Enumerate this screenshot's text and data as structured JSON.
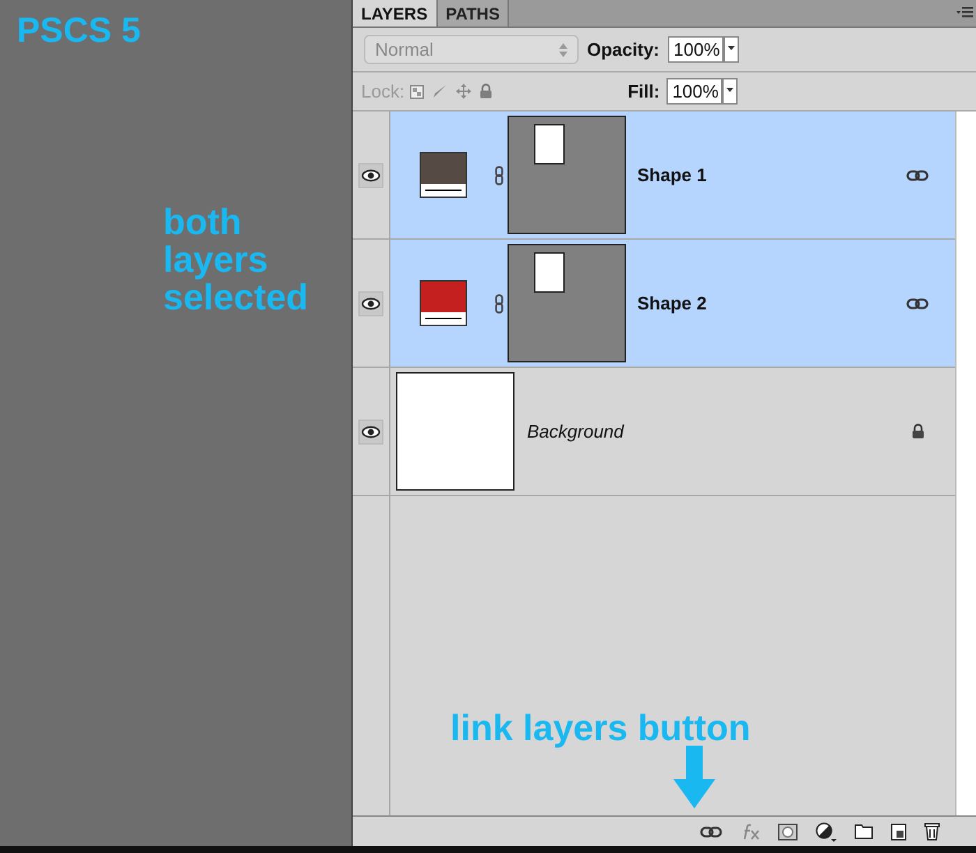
{
  "annotations": {
    "version": "PSCS 5",
    "note": "both layers selected",
    "callout": "link layers button"
  },
  "panel": {
    "tabs": [
      {
        "label": "LAYERS",
        "selected": true
      },
      {
        "label": "PATHS",
        "selected": false
      }
    ],
    "blend_mode": {
      "value": "Normal",
      "disabled": true
    },
    "opacity": {
      "label": "Opacity:",
      "value": "100%"
    },
    "lock": {
      "label": "Lock:",
      "disabled": true
    },
    "fill": {
      "label": "Fill:",
      "value": "100%"
    },
    "layers": [
      {
        "kind": "shape",
        "name": "Shape 1",
        "color": "#564a45",
        "selected": true,
        "visible": true,
        "linked": true,
        "locked": false
      },
      {
        "kind": "shape",
        "name": "Shape 2",
        "color": "#c42020",
        "selected": true,
        "visible": true,
        "linked": true,
        "locked": false
      },
      {
        "kind": "background",
        "name": "Background",
        "selected": false,
        "visible": true,
        "linked": false,
        "locked": true
      }
    ]
  }
}
